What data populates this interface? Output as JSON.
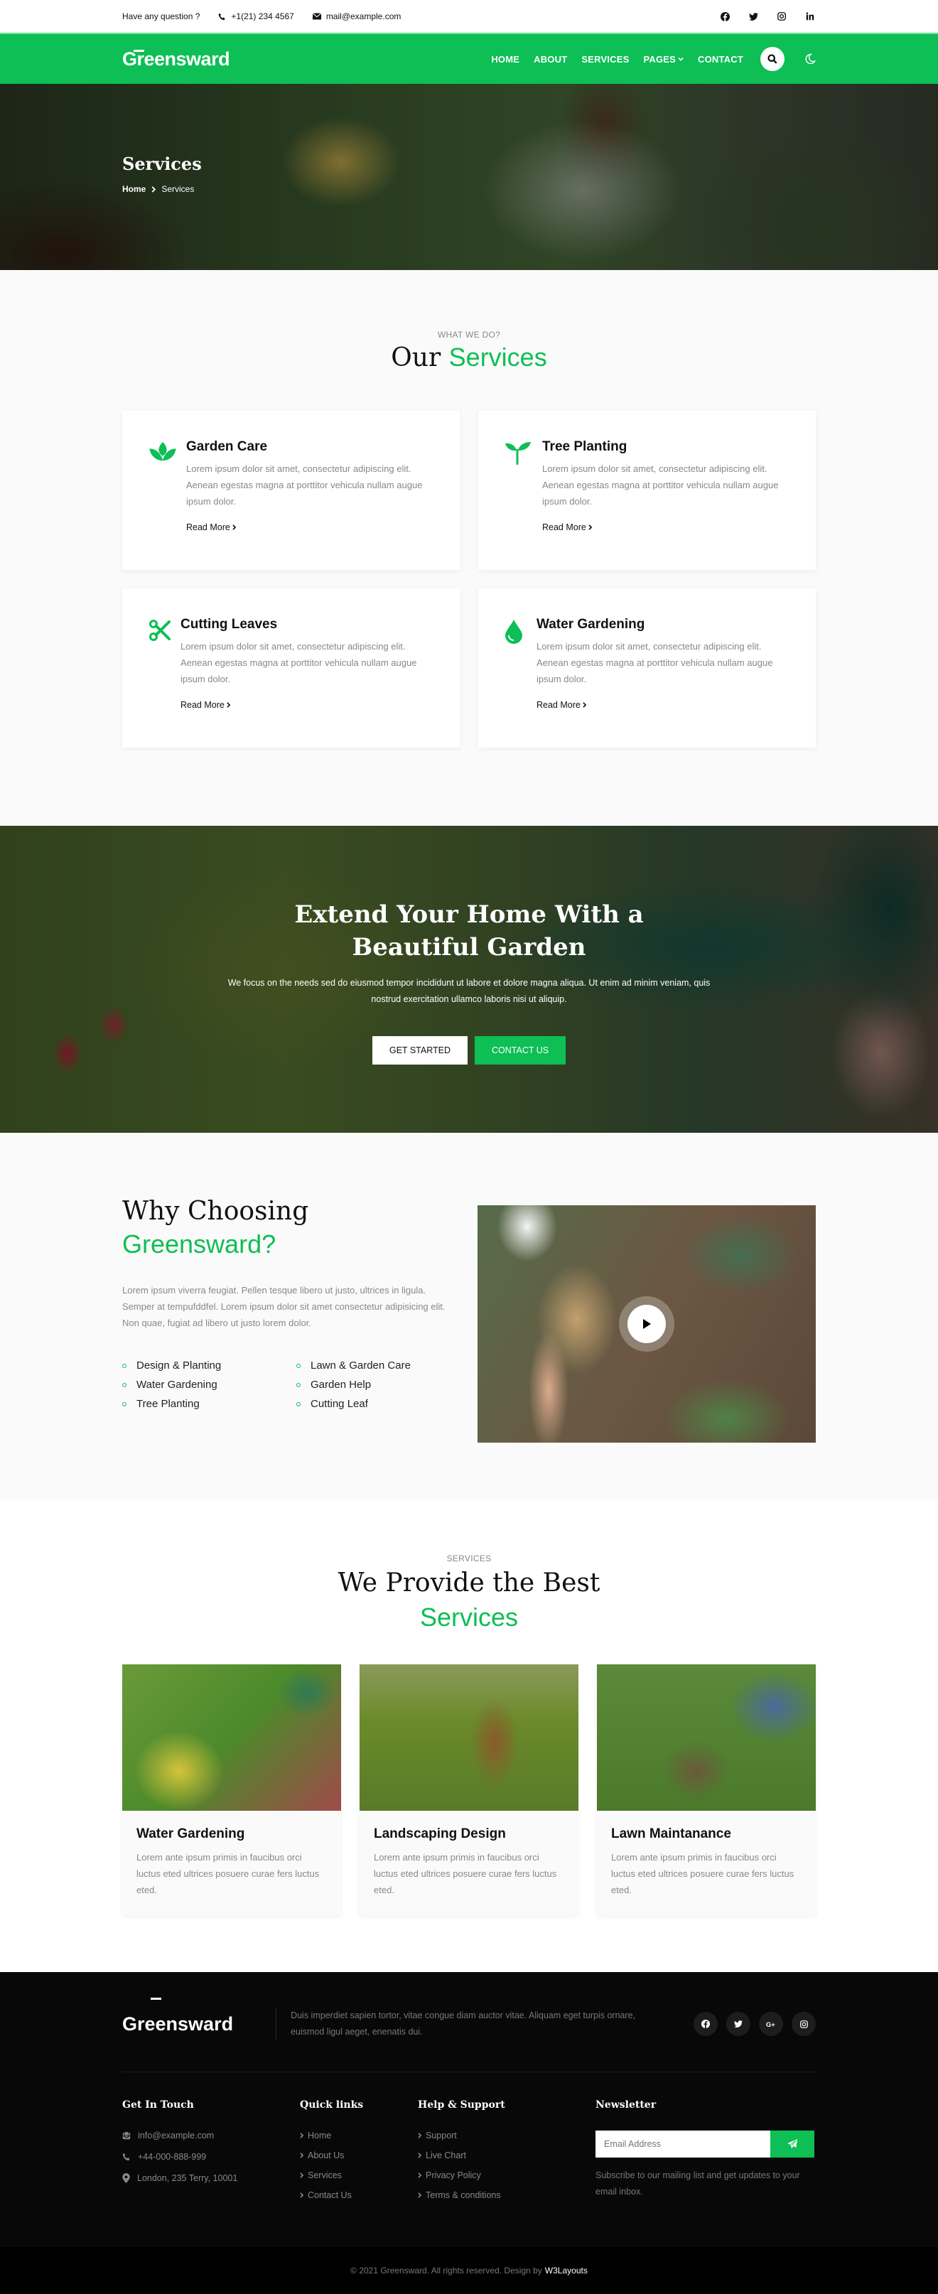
{
  "topbar": {
    "question": "Have any question ?",
    "phone": "+1(21) 234 4567",
    "email": "mail@example.com",
    "socials": [
      "facebook-icon",
      "twitter-icon",
      "instagram-icon",
      "linkedin-icon"
    ]
  },
  "nav": {
    "logo": "Greensward",
    "links": [
      "HOME",
      "ABOUT",
      "SERVICES",
      "PAGES",
      "CONTACT"
    ],
    "search_icon": "search-icon",
    "theme_icon": "moon-icon"
  },
  "hero": {
    "title": "Services",
    "breadcrumb": {
      "home": "Home",
      "current": "Services"
    }
  },
  "services": {
    "subtitle": "WHAT WE DO?",
    "title_main": "Our",
    "title_accent": "Services",
    "cards": [
      {
        "icon": "lotus-icon",
        "title": "Garden Care",
        "text": "Lorem ipsum dolor sit amet, consectetur adipiscing elit. Aenean egestas magna at porttitor vehicula nullam augue ipsum dolor.",
        "link": "Read More"
      },
      {
        "icon": "seedling-icon",
        "title": "Tree Planting",
        "text": "Lorem ipsum dolor sit amet, consectetur adipiscing elit. Aenean egestas magna at porttitor vehicula nullam augue ipsum dolor.",
        "link": "Read More"
      },
      {
        "icon": "scissors-icon",
        "title": "Cutting Leaves",
        "text": "Lorem ipsum dolor sit amet, consectetur adipiscing elit. Aenean egestas magna at porttitor vehicula nullam augue ipsum dolor.",
        "link": "Read More"
      },
      {
        "icon": "water-drop-icon",
        "title": "Water Gardening",
        "text": "Lorem ipsum dolor sit amet, consectetur adipiscing elit. Aenean egestas magna at porttitor vehicula nullam augue ipsum dolor.",
        "link": "Read More"
      }
    ]
  },
  "cta": {
    "title": "Extend Your Home With a Beautiful Garden",
    "text": "We focus on the needs sed do eiusmod tempor incididunt ut labore et dolore magna aliqua. Ut enim ad minim veniam, quis nostrud exercitation ullamco laboris nisi ut aliquip.",
    "btn_primary": "GET STARTED",
    "btn_secondary": "CONTACT US"
  },
  "why": {
    "title_main": "Why Choosing",
    "title_accent": "Greensward?",
    "text": "Lorem ipsum viverra feugiat. Pellen tesque libero ut justo, ultrices in ligula. Semper at tempufddfel. Lorem ipsum dolor sit amet consectetur adipisicing elit. Non quae, fugiat ad libero ut justo lorem dolor.",
    "features": [
      "Design & Planting",
      "Lawn & Garden Care",
      "Water Gardening",
      "Garden Help",
      "Tree Planting",
      "Cutting Leaf"
    ]
  },
  "best": {
    "subtitle": "SERVICES",
    "title_main": "We Provide the Best",
    "title_accent": "Services",
    "cards": [
      {
        "title": "Water Gardening",
        "text": "Lorem ante ipsum primis in faucibus orci luctus eted ultrices posuere curae fers luctus eted."
      },
      {
        "title": "Landscaping Design",
        "text": "Lorem ante ipsum primis in faucibus orci luctus eted ultrices posuere curae fers luctus eted."
      },
      {
        "title": "Lawn Maintanance",
        "text": "Lorem ante ipsum primis in faucibus orci luctus eted ultrices posuere curae fers luctus eted."
      }
    ]
  },
  "footer": {
    "logo": "Greensward",
    "about": "Duis imperdiet sapien tortor, vitae congue diam auctor vitae. Aliquam eget turpis ornare, euismod ligul aeget, enenatis dui.",
    "socials": [
      "facebook-icon",
      "twitter-icon",
      "google-plus-icon",
      "instagram-icon"
    ],
    "contact": {
      "heading": "Get In Touch",
      "email": "info@example.com",
      "phone": "+44-000-888-999",
      "address": "London, 235 Terry, 10001"
    },
    "quick_links": {
      "heading": "Quick links",
      "items": [
        "Home",
        "About Us",
        "Services",
        "Contact Us"
      ]
    },
    "help": {
      "heading": "Help & Support",
      "items": [
        "Support",
        "Live Chart",
        "Privacy Policy",
        "Terms & conditions"
      ]
    },
    "newsletter": {
      "heading": "Newsletter",
      "placeholder": "Email Address",
      "note": "Subscribe to our mailing list and get updates to your email inbox."
    },
    "copyright": "© 2021 Greensward. All rights reserved. Design by",
    "designer": "W3Layouts"
  },
  "colors": {
    "accent": "#0dbf55",
    "footer_bg": "#080808"
  }
}
